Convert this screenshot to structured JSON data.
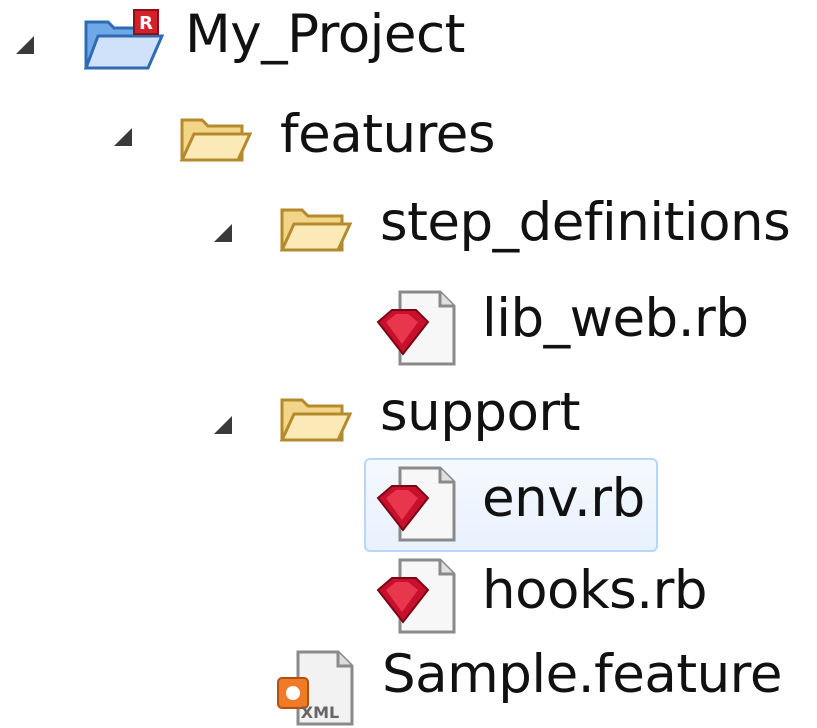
{
  "tree": {
    "nodes": [
      {
        "label": "My_Project",
        "icon": "ruby-project-folder-icon",
        "expanded": true
      },
      {
        "label": "features",
        "icon": "folder-open-icon",
        "expanded": true
      },
      {
        "label": "step_definitions",
        "icon": "folder-open-icon",
        "expanded": true
      },
      {
        "label": "lib_web.rb",
        "icon": "ruby-file-icon"
      },
      {
        "label": "support",
        "icon": "folder-open-icon",
        "expanded": true
      },
      {
        "label": "env.rb",
        "icon": "ruby-file-icon",
        "selected": true
      },
      {
        "label": "hooks.rb",
        "icon": "ruby-file-icon"
      },
      {
        "label": "Sample.feature",
        "icon": "feature-file-icon"
      }
    ]
  },
  "colors": {
    "selection_border": "#b8d6fb",
    "selection_fill": "#eaf2fe",
    "ruby_red": "#c8102e",
    "folder_yellow": "#f3d58a",
    "project_badge_red": "#d4202a"
  }
}
